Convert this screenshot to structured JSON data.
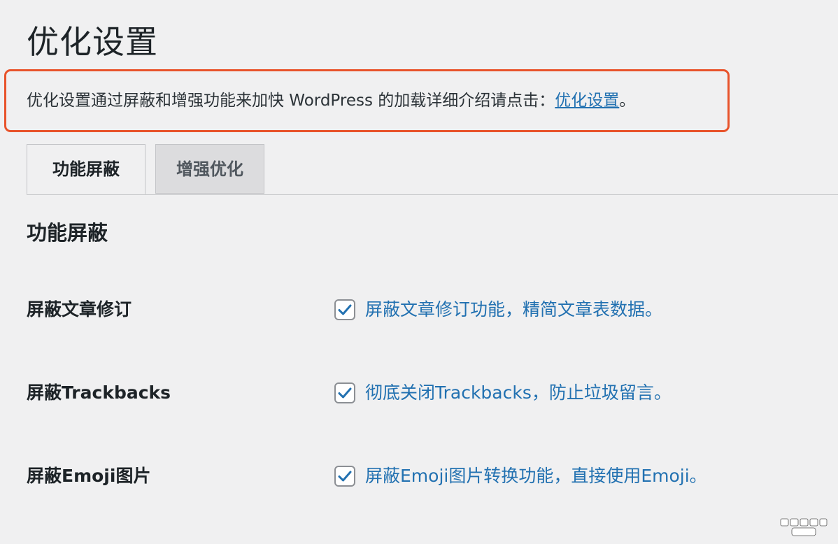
{
  "page": {
    "title": "优化设置"
  },
  "intro": {
    "text": "优化设置通过屏蔽和增强功能来加快 WordPress 的加载详细介绍请点击：",
    "link_text": "优化设置",
    "suffix": "。"
  },
  "tabs": [
    {
      "label": "功能屏蔽",
      "active": true
    },
    {
      "label": "增强优化",
      "active": false
    }
  ],
  "section": {
    "title": "功能屏蔽"
  },
  "settings": [
    {
      "label": "屏蔽文章修订",
      "checked": true,
      "description": "屏蔽文章修订功能，精简文章表数据。"
    },
    {
      "label": "屏蔽Trackbacks",
      "checked": true,
      "description": "彻底关闭Trackbacks，防止垃圾留言。"
    },
    {
      "label": "屏蔽Emoji图片",
      "checked": true,
      "description": "屏蔽Emoji图片转换功能，直接使用Emoji。"
    }
  ],
  "colors": {
    "accent": "#2271b1",
    "highlight_border": "#e8532b",
    "background": "#f0f0f1",
    "text": "#1d2327"
  },
  "icons": {
    "checkbox": "checkmark-icon",
    "watermark": "blog-logo-icon"
  }
}
